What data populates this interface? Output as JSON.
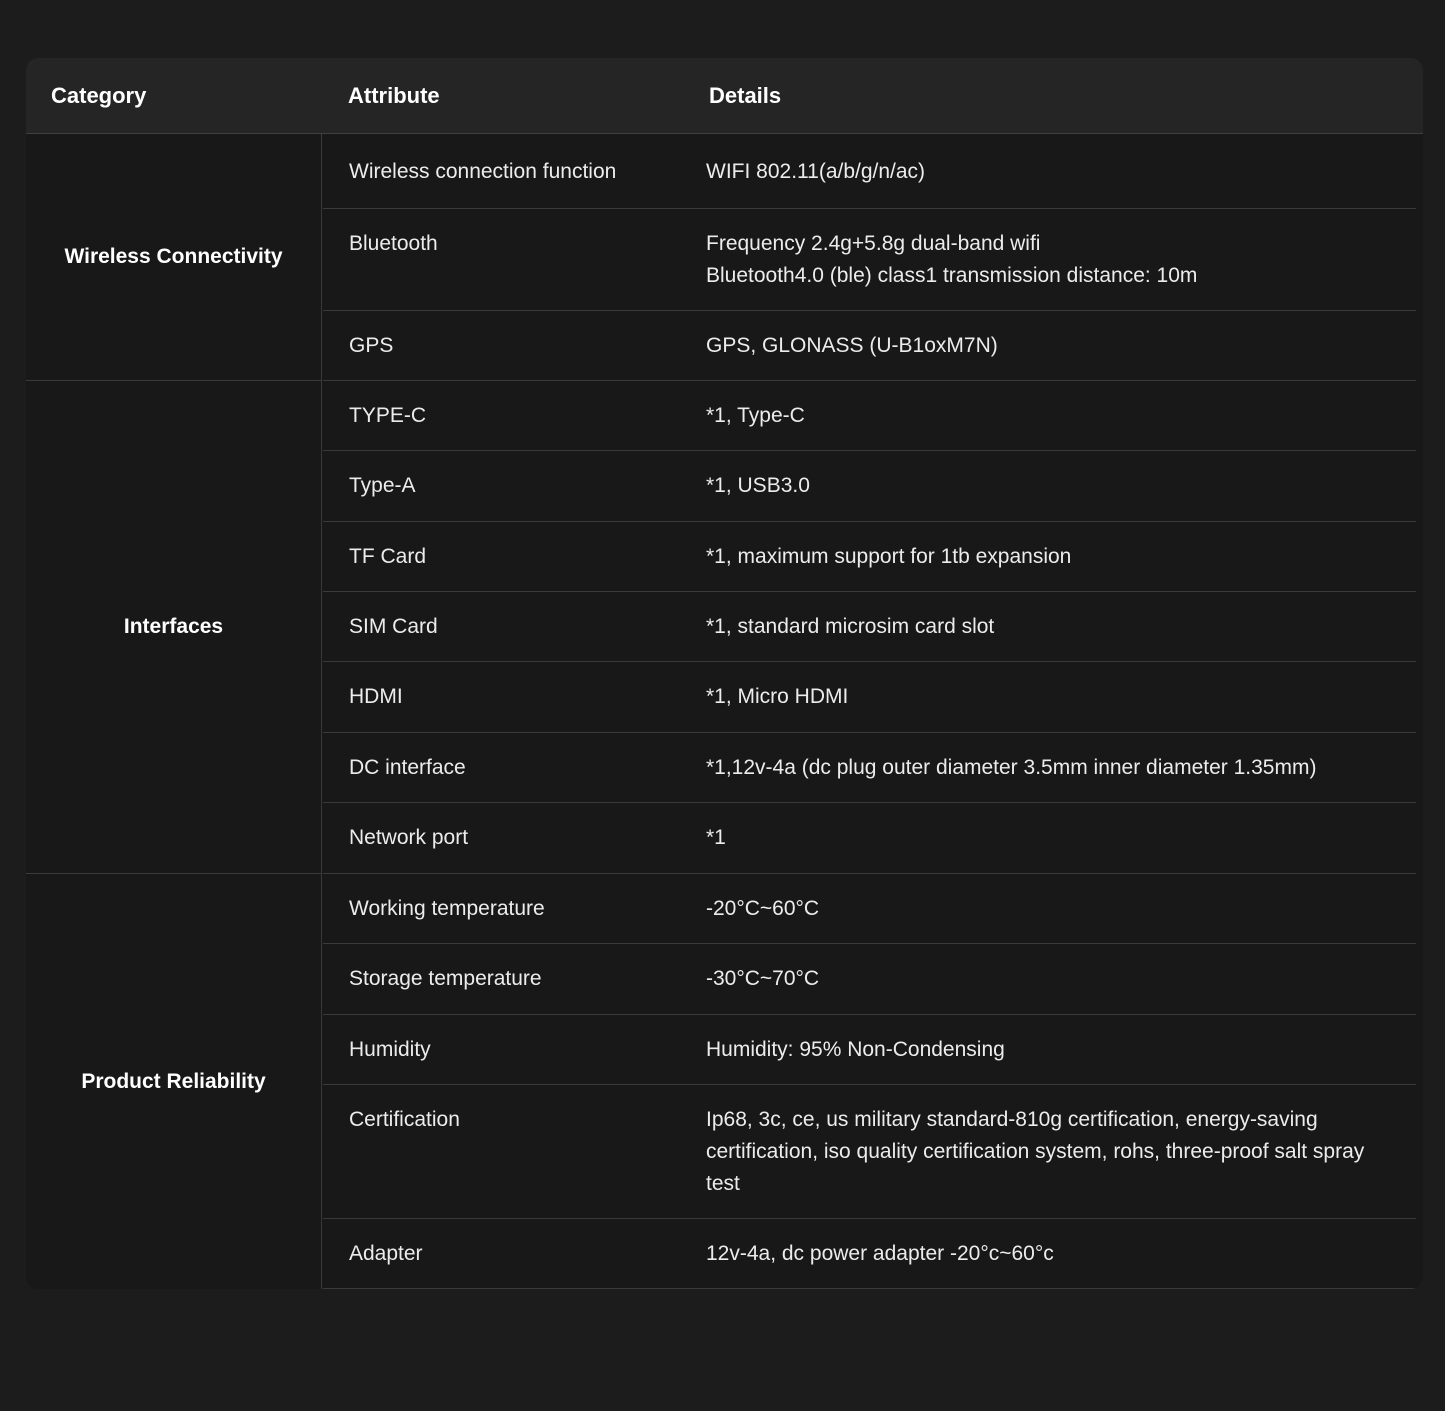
{
  "table": {
    "headers": {
      "category": "Category",
      "attribute": "Attribute",
      "details": "Details"
    },
    "groups": [
      {
        "category": "Wireless Connectivity",
        "rows": [
          {
            "attribute": "Wireless connection function",
            "details": [
              "WIFI 802.11(a/b/g/n/ac)"
            ]
          },
          {
            "attribute": "Bluetooth",
            "details": [
              "Frequency 2.4g+5.8g dual-band wifi",
              "Bluetooth4.0 (ble) class1 transmission distance: 10m"
            ]
          },
          {
            "attribute": "GPS",
            "details": [
              "GPS, GLONASS (U-B1oxM7N)"
            ]
          }
        ]
      },
      {
        "category": "Interfaces",
        "rows": [
          {
            "attribute": "TYPE-C",
            "details": [
              "*1, Type-C"
            ]
          },
          {
            "attribute": "Type-A",
            "details": [
              "*1, USB3.0"
            ]
          },
          {
            "attribute": "TF Card",
            "details": [
              "*1, maximum support for 1tb expansion"
            ]
          },
          {
            "attribute": "SIM Card",
            "details": [
              "*1, standard microsim card slot"
            ]
          },
          {
            "attribute": "HDMI",
            "details": [
              "*1, Micro HDMI"
            ]
          },
          {
            "attribute": "DC interface",
            "details": [
              "*1,12v-4a (dc plug outer diameter 3.5mm inner diameter 1.35mm)"
            ]
          },
          {
            "attribute": "Network port",
            "details": [
              "*1"
            ]
          }
        ]
      },
      {
        "category": "Product Reliability",
        "rows": [
          {
            "attribute": "Working temperature",
            "details": [
              "-20°C~60°C"
            ]
          },
          {
            "attribute": "Storage temperature",
            "details": [
              "-30°C~70°C"
            ]
          },
          {
            "attribute": "Humidity",
            "details": [
              "Humidity: 95% Non-Condensing"
            ]
          },
          {
            "attribute": "Certification",
            "details": [
              "Ip68, 3c, ce, us military standard-810g certification, energy-saving certification, iso quality certification system, rohs, three-proof salt spray test"
            ]
          },
          {
            "attribute": "Adapter",
            "details": [
              "12v-4a, dc power adapter -20°c~60°c"
            ]
          }
        ]
      }
    ]
  }
}
